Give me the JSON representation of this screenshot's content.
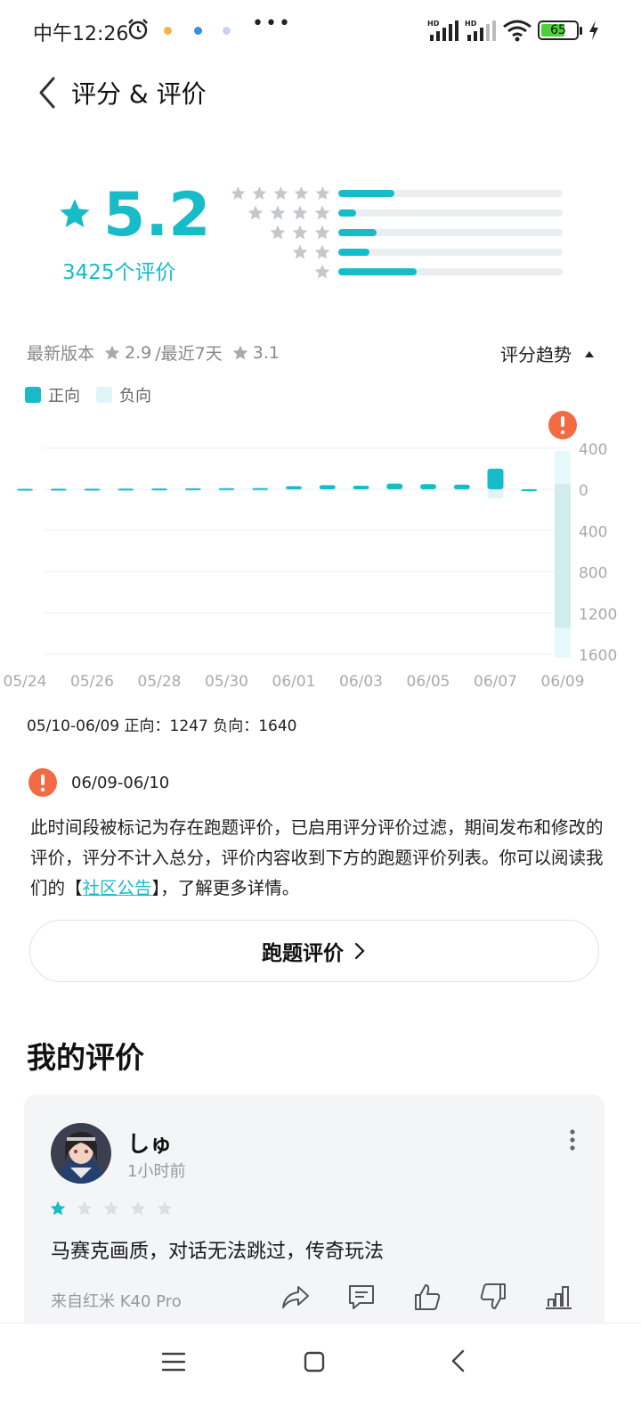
{
  "status_bar": {
    "time": "中午12:26",
    "battery": "65",
    "signal_label": "HD"
  },
  "header": {
    "title": "评分 & 评价"
  },
  "rating": {
    "score": "5.2",
    "count": "3425个评价",
    "distribution": [
      {
        "stars": 5,
        "fraction": 0.25
      },
      {
        "stars": 4,
        "fraction": 0.08
      },
      {
        "stars": 3,
        "fraction": 0.17
      },
      {
        "stars": 2,
        "fraction": 0.14
      },
      {
        "stars": 1,
        "fraction": 0.35
      }
    ]
  },
  "trend": {
    "latest_label": "最新版本",
    "latest_score": "2.9",
    "recent_label": "/最近7天",
    "recent_score": "3.1",
    "toggle_label": "评分趋势",
    "legend_positive": "正向",
    "legend_negative": "负向"
  },
  "chart_data": {
    "type": "bar",
    "categories": [
      "05/24",
      "05/25",
      "05/26",
      "05/27",
      "05/28",
      "05/29",
      "05/30",
      "05/31",
      "06/01",
      "06/02",
      "06/03",
      "06/04",
      "06/05",
      "06/06",
      "06/07",
      "06/08",
      "06/09"
    ],
    "x_tick_labels": [
      "05/24",
      "05/26",
      "05/28",
      "05/30",
      "06/01",
      "06/03",
      "06/05",
      "06/07",
      "06/09"
    ],
    "series": [
      {
        "name": "正向",
        "values": [
          4,
          5,
          5,
          6,
          8,
          10,
          11,
          12,
          30,
          40,
          35,
          55,
          50,
          45,
          200,
          0,
          0
        ]
      },
      {
        "name": "负向",
        "values": [
          2,
          2,
          3,
          3,
          3,
          4,
          4,
          5,
          8,
          10,
          9,
          12,
          11,
          10,
          90,
          0,
          1600
        ]
      }
    ],
    "y_tick_labels": [
      "400",
      "0",
      "400",
      "800",
      "1200",
      "1600"
    ],
    "ylim": [
      -1600,
      400
    ],
    "flagged_category": "06/09",
    "grid": true
  },
  "summary": {
    "text": "05/10-06/09  正向：1247   负向：1640"
  },
  "notice": {
    "date_range": "06/09-06/10",
    "text_before": "此时间段被标记为存在跑题评价，已启用评分评价过滤，期间发布和修改的评价，评分不计入总分，评价内容收到下方的跑题评价列表。你可以阅读我们的【",
    "link": "社区公告",
    "text_after": "】，了解更多详情。"
  },
  "offtopic_button": {
    "label": "跑题评价"
  },
  "my_review": {
    "section_title": "我的评价",
    "user_name": "しゅ",
    "time": "1小时前",
    "rating": 1,
    "text": "马赛克画质，对话无法跳过，传奇玩法",
    "device": "来自红米 K40 Pro"
  },
  "colors": {
    "accent": "#17bcc8",
    "negative": "#dff5f7",
    "warning": "#f26b43"
  }
}
